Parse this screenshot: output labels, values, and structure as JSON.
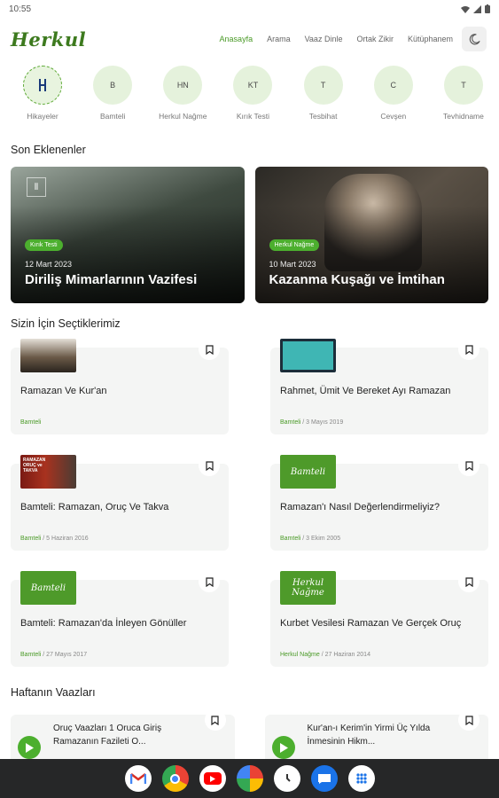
{
  "status": {
    "time": "10:55"
  },
  "header": {
    "logo": "Herkul",
    "nav": [
      "Anasayfa",
      "Arama",
      "Vaaz Dinle",
      "Ortak Zikir",
      "Kütüphanem"
    ]
  },
  "categories": [
    {
      "label": "Hikayeler",
      "initials": "H"
    },
    {
      "label": "Bamteli",
      "initials": "B"
    },
    {
      "label": "Herkul Nağme",
      "initials": "HN"
    },
    {
      "label": "Kırık Testi",
      "initials": "KT"
    },
    {
      "label": "Tesbihat",
      "initials": "T"
    },
    {
      "label": "Cevşen",
      "initials": "C"
    },
    {
      "label": "Tevhidname",
      "initials": "T"
    }
  ],
  "sections": {
    "recent": "Son Eklenenler",
    "picks": "Sizin İçin Seçtiklerimiz",
    "weekly": "Haftanın Vaazları"
  },
  "featured": [
    {
      "badge": "Kırık Testi",
      "date": "12 Mart 2023",
      "title": "Diriliş Mimarlarının Vazifesi"
    },
    {
      "badge": "Herkul Nağme",
      "date": "10 Mart 2023",
      "title": "Kazanma Kuşağı ve İmtihan"
    }
  ],
  "picks": [
    {
      "title": "Ramazan Ve Kur'an",
      "category": "Bamteli",
      "date": ""
    },
    {
      "title": "Rahmet, Ümit Ve Bereket Ayı Ramazan",
      "category": "Bamteli",
      "date": "/ 3 Mayıs 2019"
    },
    {
      "title": "Bamteli: Ramazan, Oruç Ve Takva",
      "category": "Bamteli",
      "date": "/ 5 Haziran 2016",
      "thumb_text": "RAMAZAN ORUÇ ve TAKVA"
    },
    {
      "title": "Ramazan'ı Nasıl Değerlendirmeliyiz?",
      "category": "Bamteli",
      "date": "/ 3 Ekim 2005",
      "thumb_text": "Bamteli"
    },
    {
      "title": "Bamteli: Ramazan'da İnleyen Gönüller",
      "category": "Bamteli",
      "date": "/ 27 Mayıs 2017",
      "thumb_text": "Bamteli"
    },
    {
      "title": "Kurbet Vesilesi Ramazan Ve Gerçek Oruç",
      "category": "Herkul Nağme",
      "date": "/ 27 Haziran 2014",
      "thumb_text": "Herkul Nağme"
    }
  ],
  "weekly": [
    {
      "title": "Oruç Vaazları 1 Oruca Giriş Ramazanın Fazileti O..."
    },
    {
      "title": "Kur'an-ı Kerim'in Yirmi Üç Yılda İnmesinin Hikm..."
    }
  ],
  "colors": {
    "accent": "#4a9a27",
    "logo": "#3d7a1e",
    "badge": "#4caf2e"
  },
  "dock_apps": [
    "gmail-icon",
    "chrome-icon",
    "youtube-icon",
    "photos-icon",
    "clock-icon",
    "messages-icon",
    "apps-icon"
  ]
}
